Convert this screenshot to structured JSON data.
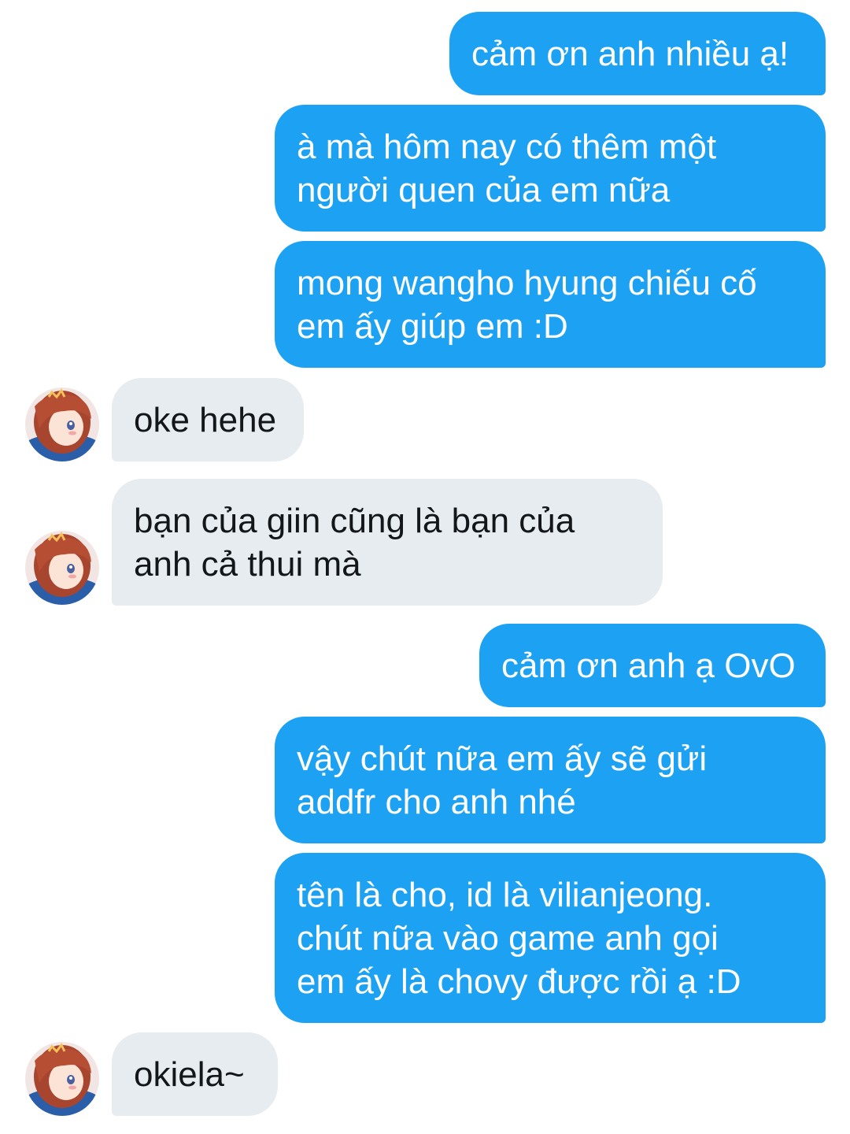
{
  "messages": [
    {
      "side": "out",
      "text": "cảm ơn anh nhiều ạ!"
    },
    {
      "side": "out",
      "text": "à mà hôm nay có thêm một\nngười quen của em nữa"
    },
    {
      "side": "out",
      "text": "mong wangho hyung chiếu cố\nem ấy giúp em :D"
    },
    {
      "side": "in",
      "text": "oke hehe"
    },
    {
      "side": "in",
      "text": "bạn của giin cũng là bạn của\nanh cả thui mà"
    },
    {
      "side": "out",
      "text": "cảm ơn anh ạ OvO"
    },
    {
      "side": "out",
      "text": "vậy chút nữa em ấy sẽ gửi\naddfr cho anh nhé"
    },
    {
      "side": "out",
      "text": "tên là cho, id là vilianjeong.\nchút nữa vào game anh gọi\nem ấy là chovy được rồi ạ :D"
    },
    {
      "side": "in",
      "text": "okiela~"
    }
  ],
  "avatar": {
    "icon": "anime-girl-avatar-icon"
  },
  "colors": {
    "outgoing_bubble": "#1da1f2",
    "incoming_bubble": "#e6ecf0",
    "outgoing_text": "#ffffff",
    "incoming_text": "#14171a"
  }
}
